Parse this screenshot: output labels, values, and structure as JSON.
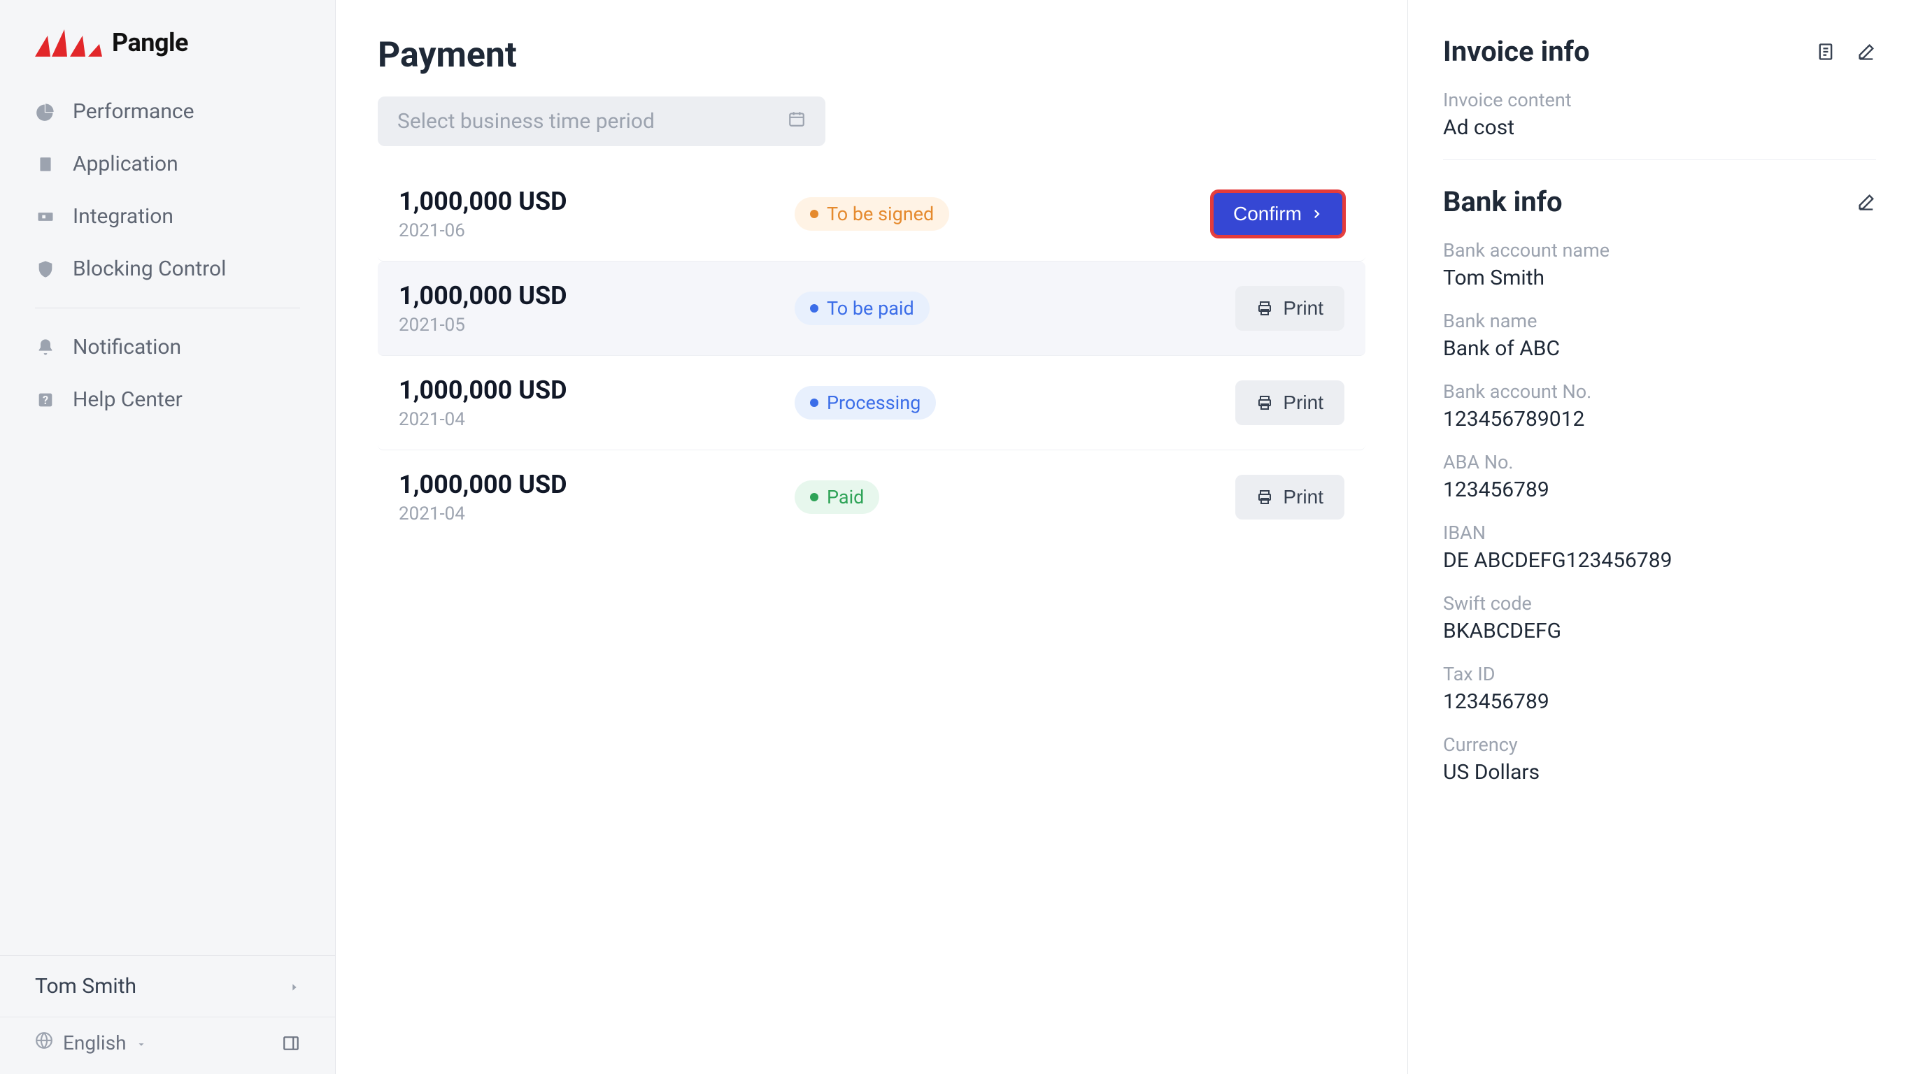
{
  "brand": {
    "name": "Pangle"
  },
  "sidebar": {
    "items": [
      {
        "label": "Performance"
      },
      {
        "label": "Application"
      },
      {
        "label": "Integration"
      },
      {
        "label": "Blocking Control"
      }
    ],
    "secondary": [
      {
        "label": "Notification"
      },
      {
        "label": "Help Center"
      }
    ],
    "user": "Tom Smith",
    "language": "English"
  },
  "page": {
    "title": "Payment",
    "datePlaceholder": "Select business time period"
  },
  "payments": [
    {
      "amount": "1,000,000 USD",
      "date": "2021-06",
      "status": "To be signed",
      "statusType": "orange",
      "action": "Confirm"
    },
    {
      "amount": "1,000,000 USD",
      "date": "2021-05",
      "status": "To be paid",
      "statusType": "blue",
      "action": "Print"
    },
    {
      "amount": "1,000,000 USD",
      "date": "2021-04",
      "status": "Processing",
      "statusType": "blue",
      "action": "Print"
    },
    {
      "amount": "1,000,000 USD",
      "date": "2021-04",
      "status": "Paid",
      "statusType": "green",
      "action": "Print"
    }
  ],
  "actionLabels": {
    "confirm": "Confirm",
    "print": "Print"
  },
  "invoice": {
    "title": "Invoice info",
    "contentLabel": "Invoice content",
    "contentValue": "Ad cost"
  },
  "bank": {
    "title": "Bank info",
    "fields": [
      {
        "label": "Bank account name",
        "value": "Tom Smith"
      },
      {
        "label": "Bank name",
        "value": "Bank of ABC"
      },
      {
        "label": "Bank account No.",
        "value": "123456789012"
      },
      {
        "label": "ABA No.",
        "value": "123456789"
      },
      {
        "label": "IBAN",
        "value": "DE ABCDEFG123456789"
      },
      {
        "label": "Swift code",
        "value": "BKABCDEFG"
      },
      {
        "label": "Tax ID",
        "value": "123456789"
      },
      {
        "label": "Currency",
        "value": "US Dollars"
      }
    ]
  }
}
